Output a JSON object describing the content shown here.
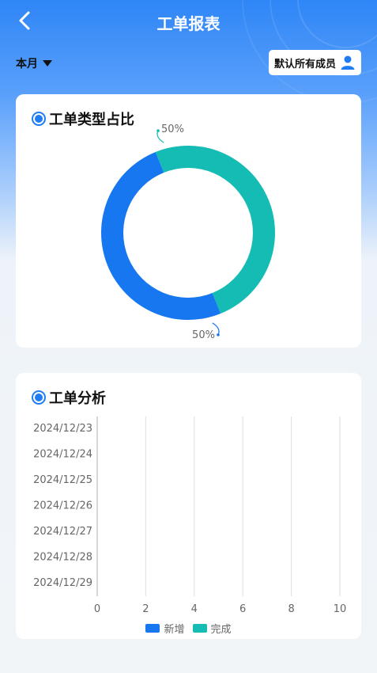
{
  "header": {
    "title": "工单报表",
    "back_icon": "chevron-left-icon"
  },
  "filters": {
    "period": "本月",
    "member": "默认所有成员",
    "member_icon": "person-icon"
  },
  "colors": {
    "blue": "#1677f0",
    "teal": "#14bcb4"
  },
  "type_card": {
    "title": "工单类型占比"
  },
  "analysis_card": {
    "title": "工单分析"
  },
  "chart_data": [
    {
      "type": "pie",
      "title": "工单类型占比",
      "donut": true,
      "slices": [
        {
          "label": "50%",
          "value": 50,
          "color": "#14bcb4"
        },
        {
          "label": "50%",
          "value": 50,
          "color": "#1677f0"
        }
      ]
    },
    {
      "type": "bar",
      "orientation": "horizontal",
      "title": "工单分析",
      "categories": [
        "2024/12/23",
        "2024/12/24",
        "2024/12/25",
        "2024/12/26",
        "2024/12/27",
        "2024/12/28",
        "2024/12/29"
      ],
      "series": [
        {
          "name": "新增",
          "values": [
            0,
            0,
            0,
            0,
            0,
            0,
            0
          ],
          "color": "#1677f0"
        },
        {
          "name": "完成",
          "values": [
            0,
            0,
            0,
            0,
            0,
            0,
            0
          ],
          "color": "#14bcb4"
        }
      ],
      "xlim": [
        0,
        10
      ],
      "xticks": [
        "0",
        "2",
        "4",
        "6",
        "8",
        "10"
      ],
      "grid": "vertical",
      "legend": "bottom-center"
    }
  ]
}
